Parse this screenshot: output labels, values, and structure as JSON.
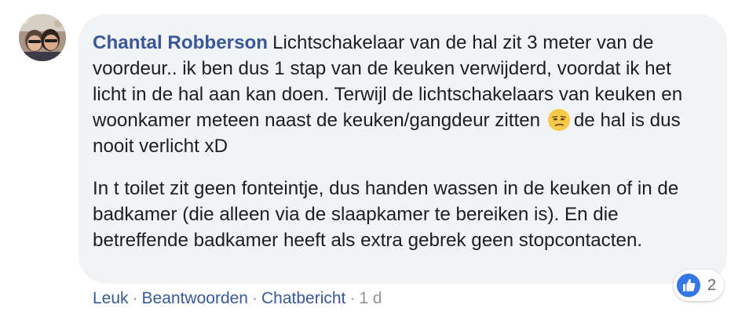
{
  "comment": {
    "author": "Chantal Robberson",
    "paragraph1_before_emoji": "Lichtschakelaar van de hal zit 3 meter van de voordeur.. ik ben dus 1 stap van de keuken verwijderd, voordat ik het licht in de hal aan kan doen. Terwijl de lichtschakelaars van keuken en woonkamer meteen naast de keuken/gangdeur zitten",
    "emoji": "unamused-face-icon",
    "paragraph1_after_emoji": "de hal is dus nooit verlicht xD",
    "paragraph2": "In t toilet zit geen fonteintje, dus handen wassen in de keuken of in de badkamer (die alleen via de slaapkamer te bereiken is). En die betreffende badkamer heeft als extra gebrek geen stopcontacten."
  },
  "reaction": {
    "icon": "like-icon",
    "count": "2",
    "color": "#3578e5"
  },
  "actions": {
    "like": "Leuk",
    "reply": "Beantwoorden",
    "message": "Chatbericht",
    "separator": "·",
    "time": "1 d"
  },
  "colors": {
    "author": "#385898",
    "bubble": "#f2f3f5",
    "text": "#1c1e21",
    "meta": "#90949c"
  }
}
